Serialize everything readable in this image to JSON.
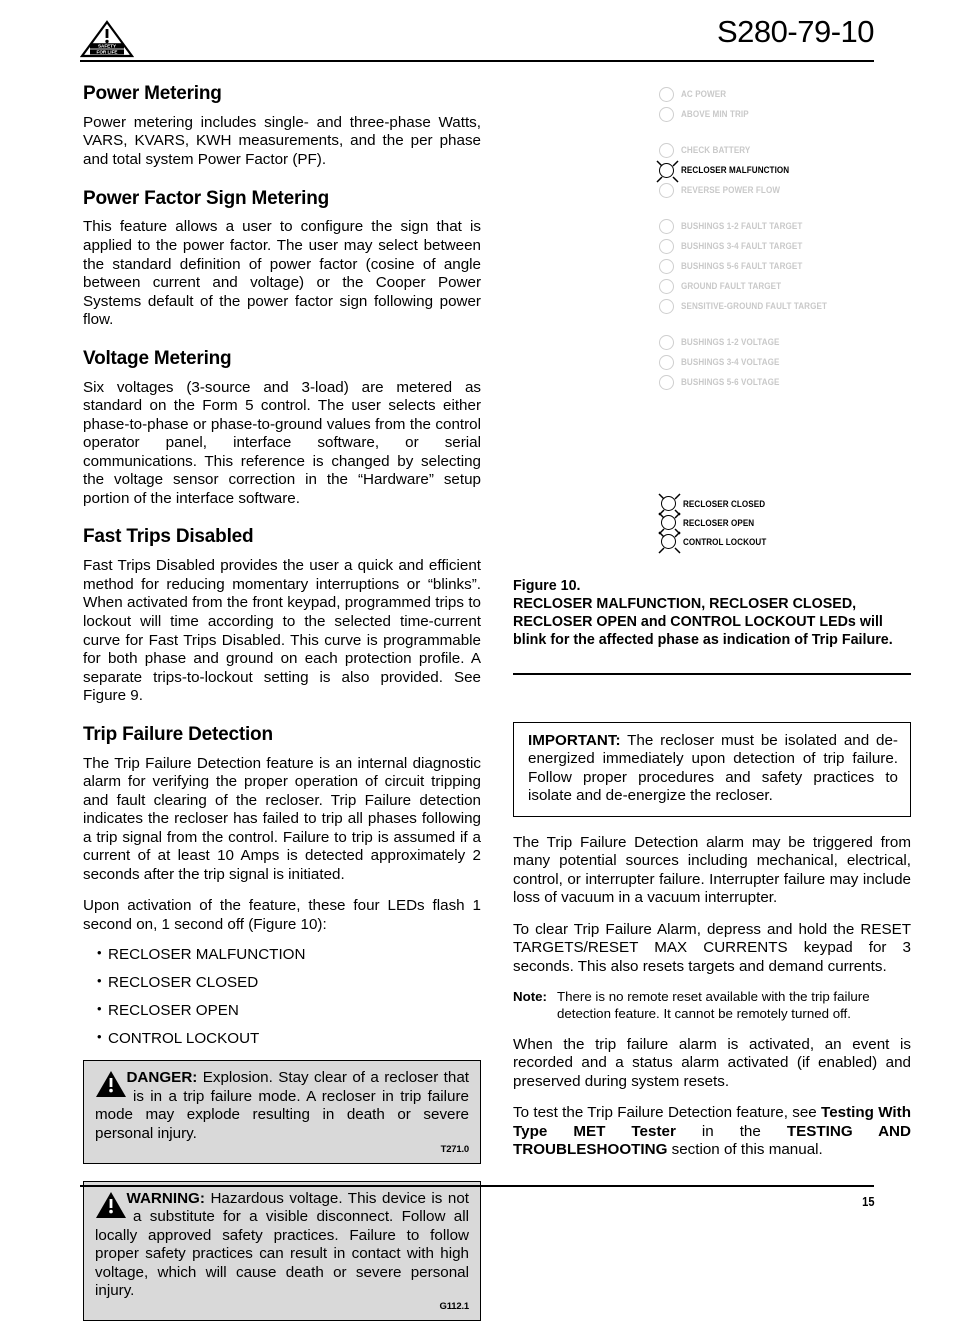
{
  "header": {
    "doc_number": "S280-79-10",
    "logo_line1": "SAFETY",
    "logo_line2": "FOR LIFE"
  },
  "left_column": {
    "sections": [
      {
        "heading": "Power Metering",
        "paragraphs": [
          "Power metering includes single- and three-phase Watts, VARS, KVARS, KWH measurements, and the per phase and total system Power Factor (PF)."
        ]
      },
      {
        "heading": "Power Factor Sign Metering",
        "paragraphs": [
          "This feature allows a user to configure the sign that is applied to the power factor. The user may select between the standard definition of power factor (cosine of angle between current and voltage) or the Cooper Power Systems default of the power factor sign following power flow."
        ]
      },
      {
        "heading": "Voltage Metering",
        "paragraphs": [
          "Six voltages (3-source and 3-load) are metered as standard on the Form 5 control. The user selects either phase-to-phase or phase-to-ground values from the control operator panel, interface software, or serial communications. This reference is changed by selecting the voltage sensor correction in the “Hardware” setup portion of the interface software."
        ]
      },
      {
        "heading": "Fast Trips Disabled",
        "paragraphs": [
          "Fast Trips Disabled provides the user a quick and efficient method for reducing momentary interruptions or “blinks”. When activated from the front keypad, programmed trips to lockout will time according to the selected time-current curve for Fast Trips Disabled. This curve is programmable for both phase and ground on each protection profile. A separate trips-to-lockout setting is also provided. See Figure 9."
        ]
      },
      {
        "heading": "Trip Failure Detection",
        "paragraphs": [
          "The Trip Failure Detection feature is an internal diagnostic alarm for verifying the proper operation of circuit tripping and fault clearing of the recloser. Trip Failure detection indicates the recloser has failed to trip all phases following a trip signal from the control. Failure to trip is assumed if a current of at least 10 Amps is detected approximately 2 seconds after the trip signal is initiated.",
          "Upon activation of the feature, these four LEDs flash 1 second on, 1 second off (Figure 10):"
        ]
      }
    ],
    "led_bullets": [
      "RECLOSER MALFUNCTION",
      "RECLOSER CLOSED",
      "RECLOSER OPEN",
      "CONTROL LOCKOUT"
    ],
    "danger_box": {
      "label": "DANGER:",
      "text": " Explosion. Stay clear of a recloser that is in a trip failure mode. A recloser in trip failure mode may explode resulting in death or severe personal injury.",
      "code": "T271.0",
      "icon": "warning-triangle-icon"
    },
    "warning_box": {
      "label": "WARNING:",
      "text": " Hazardous voltage. This device is not a substitute for a visible disconnect. Follow all locally approved safety practices. Failure to follow proper safety practices can result in contact with high voltage, which will cause death or severe personal injury.",
      "code": "G112.1",
      "icon": "warning-triangle-icon"
    }
  },
  "figure": {
    "number": "Figure 10.",
    "caption": "RECLOSER MALFUNCTION, RECLOSER CLOSED, RECLOSER OPEN and CONTROL LOCKOUT LEDs will blink for the affected phase as indication of Trip Failure.",
    "led_groups": [
      {
        "leds": [
          {
            "label": "AC POWER",
            "state": "off"
          },
          {
            "label": "ABOVE MIN TRIP",
            "state": "off"
          }
        ]
      },
      {
        "leds": [
          {
            "label": "CHECK BATTERY",
            "state": "off"
          },
          {
            "label": "RECLOSER MALFUNCTION",
            "state": "blinking"
          },
          {
            "label": "REVERSE POWER FLOW",
            "state": "off"
          }
        ]
      },
      {
        "leds": [
          {
            "label": "BUSHINGS 1-2 FAULT TARGET",
            "state": "off"
          },
          {
            "label": "BUSHINGS 3-4 FAULT TARGET",
            "state": "off"
          },
          {
            "label": "BUSHINGS 5-6 FAULT TARGET",
            "state": "off"
          },
          {
            "label": "GROUND FAULT TARGET",
            "state": "off"
          },
          {
            "label": "SENSITIVE-GROUND FAULT TARGET",
            "state": "off"
          }
        ]
      },
      {
        "leds": [
          {
            "label": "BUSHINGS 1-2 VOLTAGE",
            "state": "off"
          },
          {
            "label": "BUSHINGS 3-4 VOLTAGE",
            "state": "off"
          },
          {
            "label": "BUSHINGS 5-6 VOLTAGE",
            "state": "off"
          }
        ]
      }
    ],
    "status_leds": [
      {
        "label": "RECLOSER CLOSED",
        "state": "blinking"
      },
      {
        "label": "RECLOSER OPEN",
        "state": "blinking"
      },
      {
        "label": "CONTROL LOCKOUT",
        "state": "blinking"
      }
    ]
  },
  "right_column": {
    "important_box": {
      "label": "IMPORTANT:",
      "text": " The recloser must be isolated and de-energized immediately upon detection of trip failure. Follow proper procedures and safety practices to isolate and de-energize the recloser."
    },
    "paragraphs": [
      "The Trip Failure Detection alarm may be triggered from many potential sources including mechanical, electrical, control, or interrupter failure. Interrupter failure may include loss of vacuum in a vacuum interrupter.",
      "To clear Trip Failure Alarm, depress and hold the RESET TARGETS/RESET MAX CURRENTS keypad for 3 seconds. This also resets targets and demand currents."
    ],
    "note": {
      "label": "Note:",
      "text": "There is no remote reset available with the trip failure detection feature. It cannot be remotely turned off."
    },
    "paragraphs_after_note": [
      "When the trip failure alarm is activated, an event is recorded and a status alarm activated (if enabled) and preserved during system resets."
    ],
    "final_paragraph": {
      "part1": "To test the Trip Failure Detection feature, see ",
      "bold1": "Testing With Type MET Tester",
      "part2": " in the ",
      "bold2": "TESTING AND TROUBLESHOOTING",
      "part3": " section of this manual."
    }
  },
  "footer": {
    "page_number": "15"
  },
  "colors": {
    "callout_bg": "#d9d9d9",
    "led_off": "#c9c9c9",
    "led_on": "#000000"
  }
}
